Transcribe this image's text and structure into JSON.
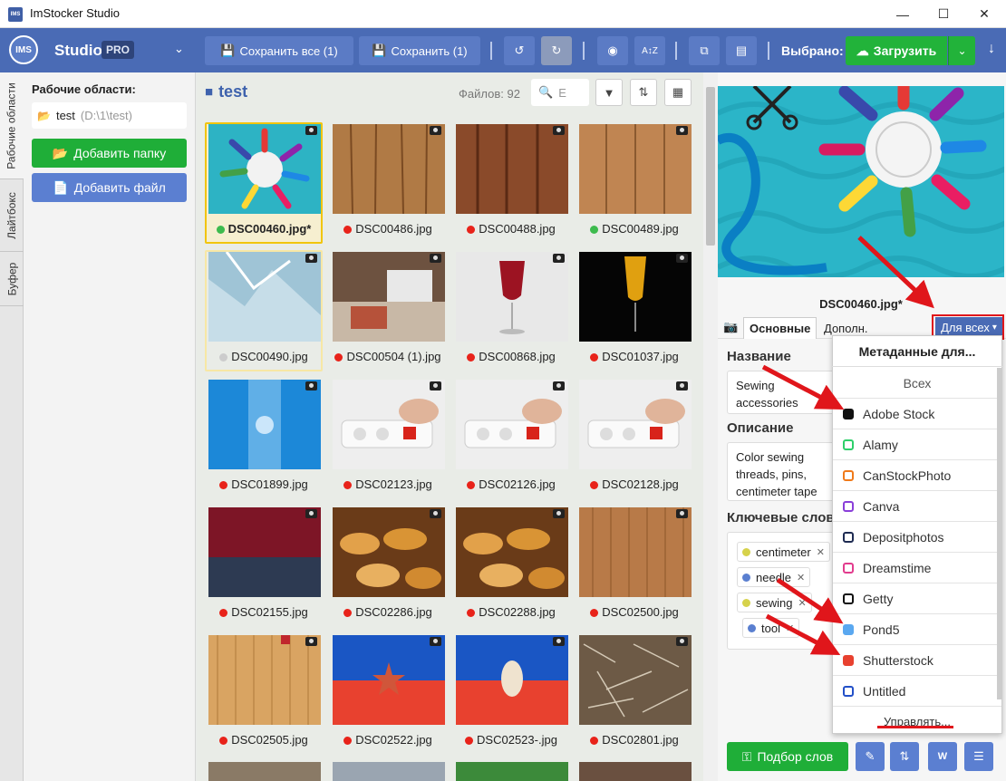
{
  "window": {
    "title": "ImStocker Studio",
    "minimize": "—",
    "maximize": "☐",
    "close": "✕"
  },
  "toolbar": {
    "logo": "IMS",
    "studio": "Studio",
    "pro": "PRO",
    "save_all": "Сохранить все (1)",
    "save": "Сохранить (1)",
    "selected": "Выбрано: 1",
    "upload": "Загрузить"
  },
  "vtabs": [
    "Рабочие области",
    "Лайтбокс",
    "Буфер"
  ],
  "left": {
    "workspaces_label": "Рабочие области:",
    "workspace_name": "test",
    "workspace_path": "(D:\\1\\test)",
    "add_folder": "Добавить папку",
    "add_file": "Добавить файл"
  },
  "grid": {
    "folder": "test",
    "files_count": "Файлов: 92",
    "search_value": "E",
    "files": [
      {
        "name": "DSC00460.jpg*",
        "dot": "#3dbb4e",
        "img": "thread"
      },
      {
        "name": "DSC00486.jpg",
        "dot": "#e8231a",
        "img": "wood1"
      },
      {
        "name": "DSC00488.jpg",
        "dot": "#e8231a",
        "img": "wood2"
      },
      {
        "name": "DSC00489.jpg",
        "dot": "#3dbb4e",
        "img": "wood3"
      },
      {
        "name": "DSC00490.jpg",
        "dot": "#cccccc",
        "img": "ice"
      },
      {
        "name": "DSC00504 (1).jpg",
        "dot": "#e8231a",
        "img": "desk"
      },
      {
        "name": "DSC00868.jpg",
        "dot": "#e8231a",
        "img": "wine"
      },
      {
        "name": "DSC01037.jpg",
        "dot": "#e8231a",
        "img": "juice"
      },
      {
        "name": "DSC01899.jpg",
        "dot": "#e8231a",
        "img": "water"
      },
      {
        "name": "DSC02123.jpg",
        "dot": "#e8231a",
        "img": "socket"
      },
      {
        "name": "DSC02126.jpg",
        "dot": "#e8231a",
        "img": "socket"
      },
      {
        "name": "DSC02128.jpg",
        "dot": "#e8231a",
        "img": "socket"
      },
      {
        "name": "DSC02155.jpg",
        "dot": "#e8231a",
        "img": "knit"
      },
      {
        "name": "DSC02286.jpg",
        "dot": "#e8231a",
        "img": "pastry"
      },
      {
        "name": "DSC02288.jpg",
        "dot": "#e8231a",
        "img": "pastry"
      },
      {
        "name": "DSC02500.jpg",
        "dot": "#e8231a",
        "img": "bamboo1"
      },
      {
        "name": "DSC02505.jpg",
        "dot": "#e8231a",
        "img": "bamboo2"
      },
      {
        "name": "DSC02522.jpg",
        "dot": "#e8231a",
        "img": "star"
      },
      {
        "name": "DSC02523-.jpg",
        "dot": "#e8231a",
        "img": "shell"
      },
      {
        "name": "DSC02801.jpg",
        "dot": "#e8231a",
        "img": "grass"
      }
    ]
  },
  "right": {
    "preview_name": "DSC00460.jpg*",
    "tab_main": "Основные",
    "tab_extra": "Дополн.",
    "for_all": "Для всех",
    "title_label": "Название",
    "title_value": "Sewing accessories",
    "desc_label": "Описание",
    "desc_value": "Color sewing threads, pins, centimeter tape",
    "kw_label": "Ключевые слова",
    "keywords": [
      {
        "text": "centimeter",
        "dot": "#d6d24b"
      },
      {
        "text": "needle",
        "dot": "#5a7fd0"
      },
      {
        "text": "sewing",
        "dot": "#d6d24b"
      },
      {
        "text": "tool",
        "dot": "#5a7fd0"
      }
    ],
    "pick_words": "Подбор слов"
  },
  "dropdown": {
    "header": "Метаданные для...",
    "all": "Всех",
    "items": [
      {
        "name": "Adobe Stock",
        "color": "#111111",
        "fill": true
      },
      {
        "name": "Alamy",
        "color": "#2ecf6a",
        "fill": false
      },
      {
        "name": "CanStockPhoto",
        "color": "#f07a1a",
        "fill": false
      },
      {
        "name": "Canva",
        "color": "#8a3fd9",
        "fill": false
      },
      {
        "name": "Depositphotos",
        "color": "#1e2b52",
        "fill": false
      },
      {
        "name": "Dreamstime",
        "color": "#e23c8e",
        "fill": false
      },
      {
        "name": "Getty",
        "color": "#111111",
        "fill": false
      },
      {
        "name": "Pond5",
        "color": "#5aa8f0",
        "fill": true
      },
      {
        "name": "Shutterstock",
        "color": "#e8412f",
        "fill": true
      },
      {
        "name": "Untitled",
        "color": "#2350c8",
        "fill": false
      }
    ],
    "manage": "Управлять..."
  }
}
